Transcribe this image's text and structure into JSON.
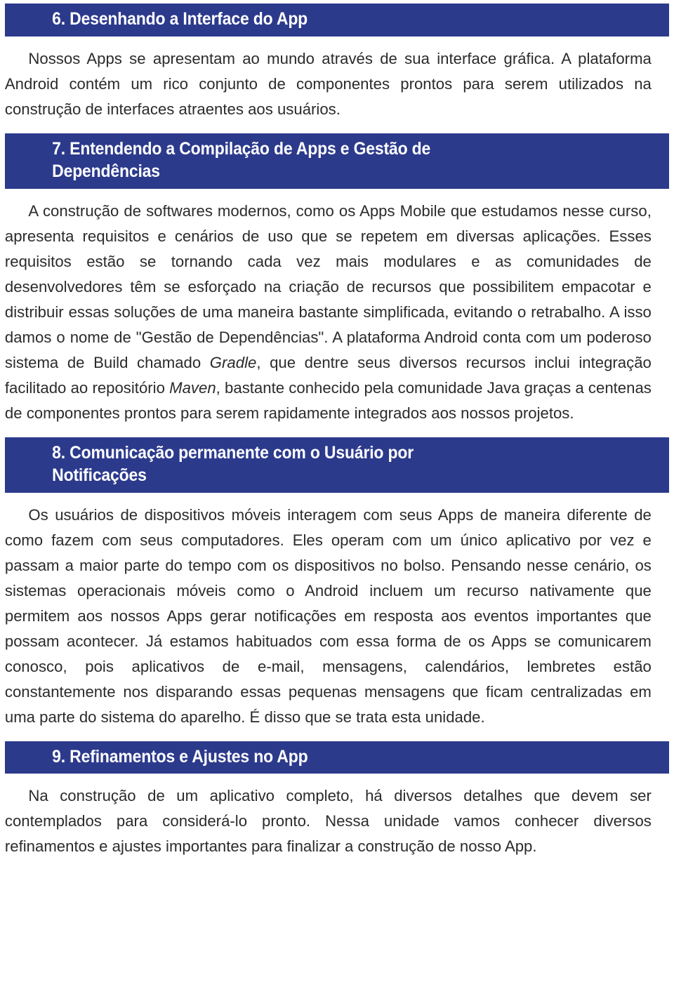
{
  "document": {
    "accent_color": "#2c3a8c",
    "text_color": "#2b2b2b",
    "background_color": "#ffffff",
    "sections": [
      {
        "number": "6",
        "heading": "6. Desenhando a Interface do App",
        "body_html": "Nossos Apps se apresentam ao mundo através de sua interface gráfica. A plataforma Android contém um rico conjunto de componentes prontos para serem utilizados na construção de interfaces atraentes aos usuários."
      },
      {
        "number": "7",
        "heading": "7. Entendendo a Compilação de Apps e Gestão de\nDependências",
        "body_html": "A construção de softwares modernos, como os Apps Mobile que estudamos nesse curso, apresenta requisitos e cenários de uso que se repetem em diversas aplicações. Esses requisitos estão se tornando cada vez mais modulares e as comunidades de desenvolvedores têm se esforçado na criação de recursos que possibilitem empacotar e distribuir essas soluções de uma maneira bastante simplificada, evitando o retrabalho. A isso damos o nome de \"Gestão de Dependências\". A plataforma Android conta com um poderoso sistema de Build chamado <em>Gradle</em>, que dentre seus diversos recursos inclui integração facilitado ao repositório <em>Maven</em>, bastante conhecido pela comunidade Java graças a centenas de componentes prontos para serem rapidamente integrados aos nossos projetos."
      },
      {
        "number": "8",
        "heading": "8. Comunicação permanente com o Usuário por\nNotificações",
        "body_html": "Os usuários de dispositivos móveis interagem com seus Apps de maneira diferente de como fazem com seus computadores. Eles operam com um único aplicativo por vez e passam a maior parte do tempo com os dispositivos no bolso. Pensando nesse cenário, os sistemas operacionais móveis como o Android incluem um recurso nativamente que permitem aos nossos Apps gerar notificações em resposta aos eventos importantes que possam acontecer. Já estamos habituados com essa forma de os Apps se comunicarem conosco, pois aplicativos de e-mail, mensagens, calendários, lembretes estão constantemente nos disparando essas pequenas mensagens que ficam centralizadas em uma parte do sistema do aparelho. É disso que se trata esta unidade."
      },
      {
        "number": "9",
        "heading": "9. Refinamentos e Ajustes no App",
        "body_html": "Na construção de um aplicativo completo, há diversos detalhes que devem ser contemplados para considerá-lo pronto. Nessa unidade vamos conhecer diversos refinamentos e ajustes importantes para finalizar a construção de nosso App."
      }
    ]
  }
}
